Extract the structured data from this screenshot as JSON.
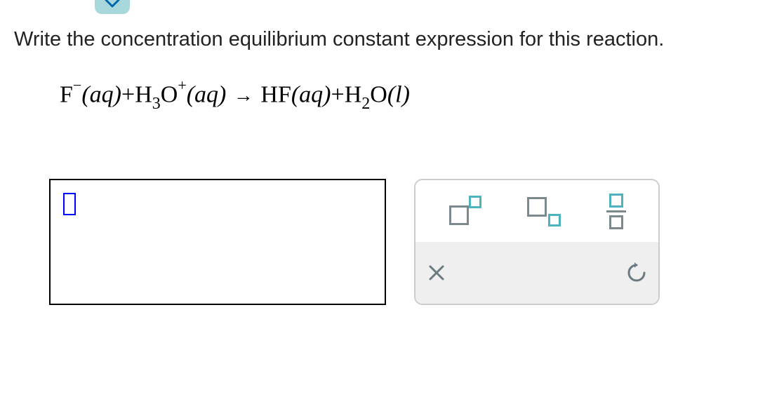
{
  "question": "Write the concentration equilibrium constant expression for this reaction.",
  "equation": {
    "species1": "F",
    "species1_charge": "−",
    "species1_phase": "(aq)",
    "plus1": "+",
    "species2_H": "H",
    "species2_sub": "3",
    "species2_O": "O",
    "species2_charge": "+",
    "species2_phase": "(aq)",
    "arrow": "→",
    "species3": "HF",
    "species3_phase": "(aq)",
    "plus2": "+",
    "species4_H": "H",
    "species4_sub": "2",
    "species4_O": "O",
    "species4_phase": "(l)"
  },
  "tools": {
    "superscript": "superscript",
    "subscript": "subscript",
    "fraction": "fraction",
    "clear": "clear",
    "reset": "reset"
  }
}
